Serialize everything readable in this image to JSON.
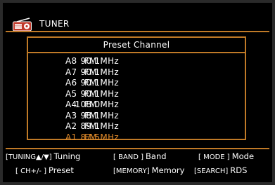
{
  "header": {
    "title": "TUNER",
    "icon": "radio-icon",
    "accent_color": "#c07a27"
  },
  "panel": {
    "title": "Preset Channel",
    "highlight_color": "#e08a2a",
    "presets": [
      {
        "preset": "A8",
        "band": "FM",
        "freq": "90.1MHz"
      },
      {
        "preset": "A7",
        "band": "FM",
        "freq": "90.1MHz"
      },
      {
        "preset": "A6",
        "band": "FM",
        "freq": "90.1MHz"
      },
      {
        "preset": "A5",
        "band": "FM",
        "freq": "90.1MHz"
      },
      {
        "preset": "A4",
        "band": "FM",
        "freq": "108.0MHz"
      },
      {
        "preset": "A3",
        "band": "FM",
        "freq": "98.1MHz"
      },
      {
        "preset": "A2",
        "band": "FM",
        "freq": "89.1MHz"
      },
      {
        "preset": "A1",
        "band": "FM",
        "freq": "87.5MHz"
      }
    ],
    "selected_preset": "A1"
  },
  "footer": {
    "hints": [
      {
        "key": "[TUNING▲/▼]",
        "label": "Tuning"
      },
      {
        "key": "[ BAND ]",
        "label": "Band"
      },
      {
        "key": "[ MODE ]",
        "label": "Mode"
      },
      {
        "key": "[ CH+/- ]",
        "label": "Preset"
      },
      {
        "key": "[MEMORY]",
        "label": "Memory"
      },
      {
        "key": "[SEARCH]",
        "label": "RDS"
      }
    ]
  }
}
